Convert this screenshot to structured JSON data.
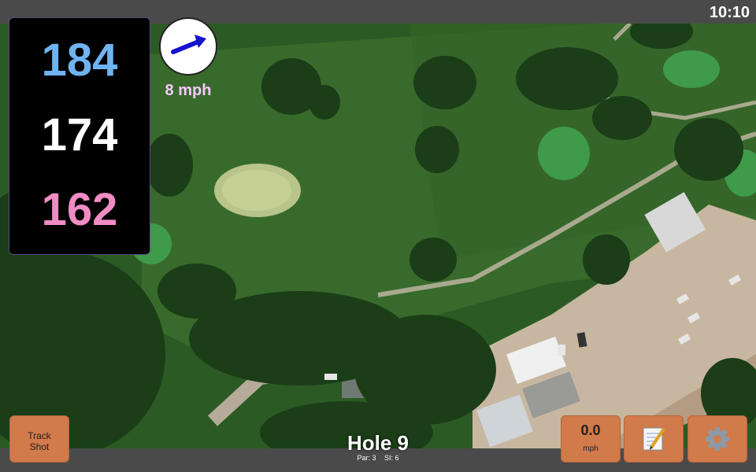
{
  "status": {
    "time": "10:10"
  },
  "distances": {
    "back": "184",
    "middle": "174",
    "front": "162"
  },
  "wind": {
    "speed": "8 mph",
    "direction_icon": "arrow-icon"
  },
  "hole": {
    "title": "Hole 9",
    "par": "Par: 3",
    "si": "SI: 6"
  },
  "buttons": {
    "track_line1": "Track",
    "track_line2": "Shot",
    "speed_value": "0.0",
    "speed_unit": "mph",
    "notes_icon": "notepad-icon",
    "settings_icon": "gear-icon"
  },
  "colors": {
    "back": "#6fb3f0",
    "middle": "#ffffff",
    "front": "#f08cc4",
    "wind_text": "#f8c8ff",
    "button": "#d17a4a"
  }
}
